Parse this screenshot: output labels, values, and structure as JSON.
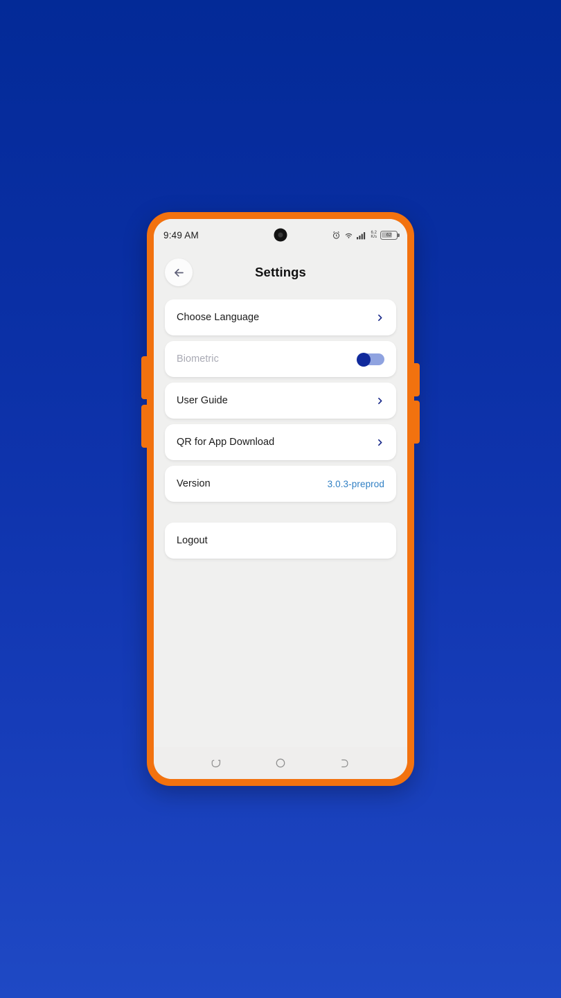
{
  "background": {
    "gradient_top": "#032a97",
    "gradient_bottom": "#1f49c4"
  },
  "device": {
    "frame_color": "#f2720f",
    "screen_bg": "#f0f0ef"
  },
  "status_bar": {
    "time": "9:49 AM",
    "alarm_icon": "alarm-clock-icon",
    "wifi_icon": "wifi-icon",
    "signal_icon": "cellular-signal-icon",
    "network_speed_value": "6.2",
    "network_speed_unit": "K/s",
    "battery_percent": "62",
    "camera": "front-camera-punch-hole"
  },
  "app_bar": {
    "back_icon": "arrow-left-icon",
    "title": "Settings"
  },
  "colors": {
    "chevron": "#1a2a8a",
    "accent_blue": "#2f7fc4",
    "toggle_knob": "#102a9c",
    "toggle_track": "#8fa3e0",
    "back_arrow": "#5f6078"
  },
  "settings": {
    "items": [
      {
        "label": "Choose Language",
        "type": "chevron",
        "disabled": false,
        "name": "choose-language"
      },
      {
        "label": "Biometric",
        "type": "toggle",
        "disabled": true,
        "toggle_on": false,
        "name": "biometric"
      },
      {
        "label": "User Guide",
        "type": "chevron",
        "disabled": false,
        "name": "user-guide"
      },
      {
        "label": "QR for App Download",
        "type": "chevron",
        "disabled": false,
        "name": "qr-for-app-download"
      },
      {
        "label": "Version",
        "type": "value",
        "value": "3.0.3-preprod",
        "disabled": false,
        "name": "version"
      },
      {
        "label": "Logout",
        "type": "plain",
        "disabled": false,
        "name": "logout"
      }
    ]
  },
  "nav_bar": {
    "recents_icon": "recents-icon",
    "home_icon": "home-circle-icon",
    "back_icon": "back-arc-icon"
  }
}
